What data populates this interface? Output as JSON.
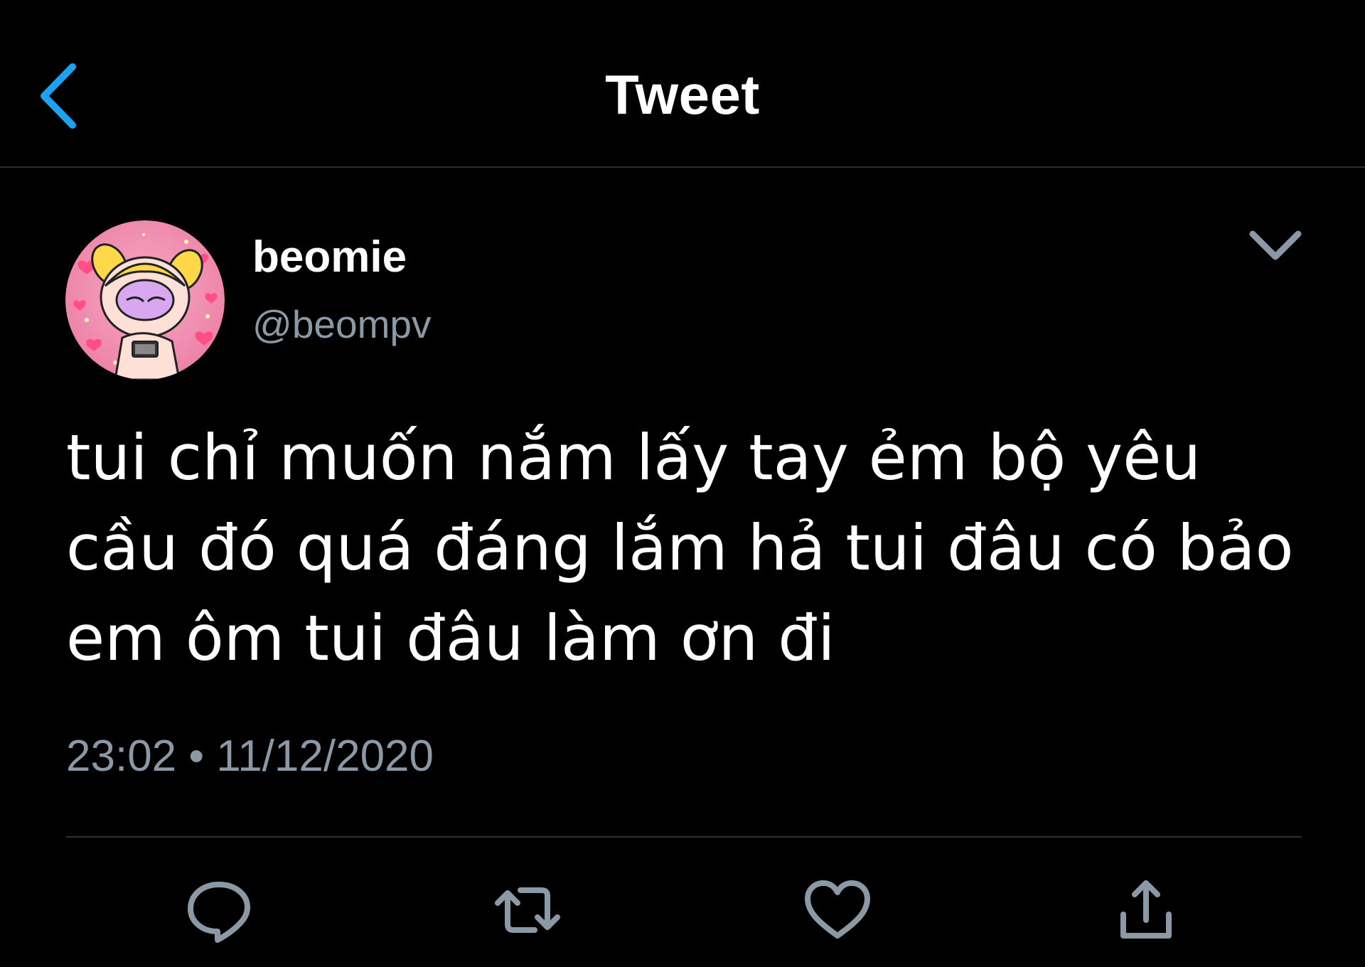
{
  "header": {
    "title": "Tweet",
    "back_icon": "chevron-left-icon",
    "accent_color": "#1da1f2"
  },
  "tweet": {
    "author": {
      "display_name": "beomie",
      "handle": "@beompv",
      "avatar": "avatar-image"
    },
    "text": "tui chỉ muốn nắm lấy tay ẻm bộ yêu cầu đó quá đáng lắm hả tui đâu có bảo em ôm tui đâu làm ơn đi",
    "timestamp": "23:02 • 11/12/2020",
    "more_icon": "chevron-down-icon"
  },
  "actions": [
    {
      "name": "reply",
      "icon": "comment-icon"
    },
    {
      "name": "retweet",
      "icon": "retweet-icon"
    },
    {
      "name": "like",
      "icon": "heart-icon"
    },
    {
      "name": "share",
      "icon": "share-icon"
    }
  ],
  "colors": {
    "background": "#000000",
    "text_primary": "#ffffff",
    "text_secondary": "#8b98a5",
    "divider": "#2f3336"
  }
}
